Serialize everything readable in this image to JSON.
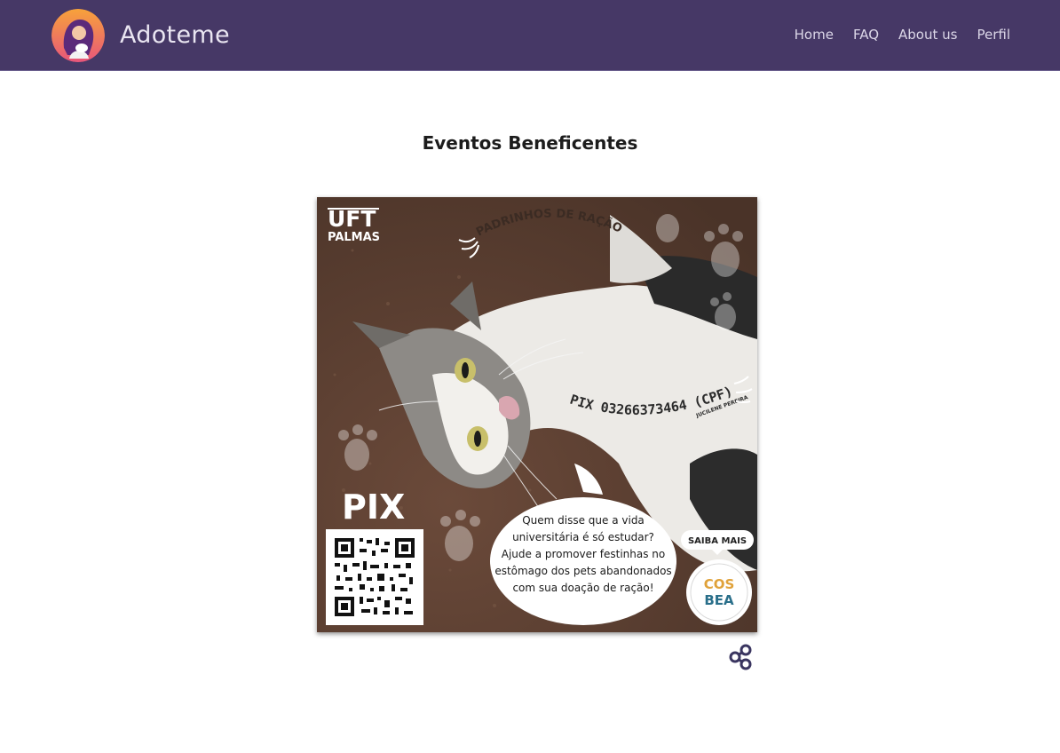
{
  "app": {
    "brand": "Adoteme",
    "nav": [
      {
        "label": "Home"
      },
      {
        "label": "FAQ"
      },
      {
        "label": "About us"
      },
      {
        "label": "Perfil"
      }
    ]
  },
  "page": {
    "title": "Eventos Beneficentes"
  },
  "poster": {
    "institution_top": "UFT",
    "institution_bottom": "PALMAS",
    "headline": "PADRINHOS DE RAÇÃO",
    "pix_key": "PIX 03266373464 (CPF)",
    "pix_owner": "JUCILENE PEREIRA",
    "pix_label": "PIX",
    "speech_lines": [
      "Quem disse que a vida",
      "universitária é só estudar?",
      "Ajude a promover festinhas no",
      "estômago dos pets abandonados",
      "com sua doação de ração!"
    ],
    "more_button": "SAIBA MAIS",
    "badge_text_1": "COS",
    "badge_text_2": "BEA"
  },
  "colors": {
    "navbar": "#463866",
    "share_icon": "#3a3560"
  },
  "icons": {
    "share": "share-icon",
    "logo": "adoteme-logo"
  }
}
